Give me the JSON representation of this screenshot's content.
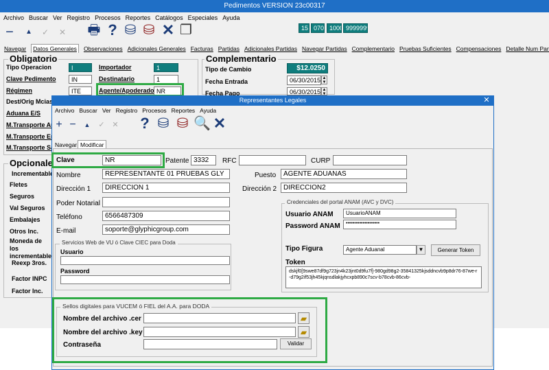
{
  "main_window": {
    "title": "Pedimentos VERSION 23c00317",
    "menu": [
      "Archivo",
      "Buscar",
      "Ver",
      "Registro",
      "Procesos",
      "Reportes",
      "Catálogos",
      "Especiales",
      "Ayuda"
    ],
    "counters": [
      "15",
      "070",
      "1000",
      "9999999"
    ],
    "tabs": [
      "Navegar",
      "Datos Generales",
      "Observaciones",
      "Adicionales Generales",
      "Facturas",
      "Partidas",
      "Adicionales Partidas",
      "Navegar Partidas",
      "Complementario",
      "Pruebas Suficientes",
      "Compensaciones",
      "Detalle Num Parte"
    ],
    "obligatorio": {
      "title": "Obligatorio",
      "labels": [
        "Tipo Operacion",
        "Clave Pedimento",
        "Régimen",
        "Dest/Orig Mcias",
        "Aduana E/S",
        "M.Transporte Arr",
        "M.Transporte Ent",
        "M.Transporte Sal"
      ],
      "values": [
        "I",
        "IN",
        "ITE"
      ],
      "right_labels": [
        "Importador",
        "Destinatario",
        "Agente/Apoderado"
      ],
      "right_values": [
        "1",
        "1",
        "NR"
      ]
    },
    "complementario": {
      "title": "Complementario",
      "tipo_cambio_label": "Tipo de Cambio",
      "tipo_cambio_value": "$12.0250",
      "fecha_entrada_label": "Fecha Entrada",
      "fecha_entrada_value": "06/30/2015",
      "fecha_pago_label": "Fecha Pago",
      "fecha_pago_value": "06/30/2015"
    },
    "opcionales": {
      "title": "Opcionales",
      "incrementables": "Incrementables",
      "labels": [
        "Fletes",
        "Seguros",
        "Val Seguros",
        "Embalajes",
        "Otros Inc.",
        "Moneda de los incrementables"
      ],
      "bottom_labels": [
        "Reexp 3ros.",
        "Factor INPC",
        "Factor Inc."
      ]
    }
  },
  "dialog": {
    "title": "Representantes Legales",
    "menu": [
      "Archivo",
      "Buscar",
      "Ver",
      "Registro",
      "Procesos",
      "Reportes",
      "Ayuda"
    ],
    "tabs": [
      "Navegar",
      "Modificar"
    ],
    "clave_label": "Clave",
    "clave_value": "NR",
    "patente_label": "Patente",
    "patente_value": "3332",
    "rfc_label": "RFC",
    "curp_label": "CURP",
    "nombre_label": "Nombre",
    "nombre_value": "REPRESENTANTE 01 PRUEBAS GLY",
    "puesto_label": "Puesto",
    "puesto_value": "AGENTE ADUANAS",
    "direccion1_label": "Dirección 1",
    "direccion1_value": "DIRECCION 1",
    "direccion2_label": "Dirección 2",
    "direccion2_value": "DIRECCION2",
    "poder_label": "Poder Notarial",
    "telefono_label": "Teléfono",
    "telefono_value": "6566487309",
    "email_label": "E-mail",
    "email_value": "soporte@glyphicgroup.com",
    "servicios_title": "Servicios Web de VU ó Clave CIEC para Doda",
    "usuario_label": "Usuario",
    "password_label": "Password",
    "anam_title": "Credenciales del portal ANAM (AVC y DVC)",
    "usuario_anam_label": "Usuario ANAM",
    "usuario_anam_value": "UsuarioANAM",
    "password_anam_label": "Password ANAM",
    "password_anam_value": "••••••••••••••••••••",
    "tipo_figura_label": "Tipo Figura",
    "tipo_figura_value": "Agente Aduanal",
    "generar_token": "Generar Token",
    "token_label": "Token",
    "token_value": "dskjf0[9swe87df9g723jn4k23jnt0d9fu7f]-980gd98g2-35841325kjsddncvb9p8dr76-87we-r-d79g2if53jh45kjqnsdlakjyhcxpb890c7scv-b78cvb-86cvb-",
    "sellos_title": "Sellos digitales para VUCEM ó FIEL del A.A. para DODA",
    "cer_label": "Nombre del archivo .cer",
    "key_label": "Nombre del archivo .key",
    "contrasena_label": "Contraseña",
    "validar": "Validar"
  },
  "colors": {
    "titlebar": "#1f6fc6",
    "teal": "#0f7d7d",
    "highlight": "#2eaa44"
  }
}
